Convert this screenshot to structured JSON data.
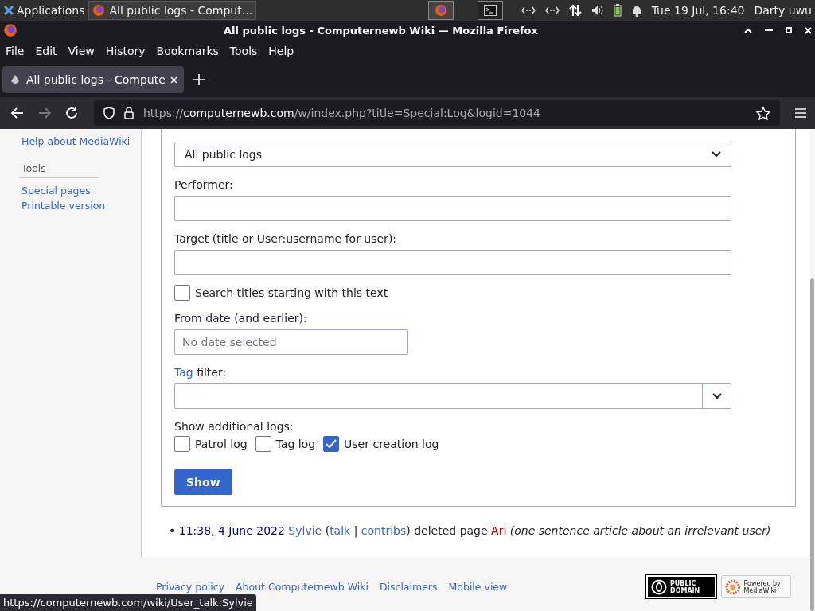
{
  "taskbar": {
    "apps_label": "Applications",
    "window_button": "All public logs - Comput...",
    "clock": "Tue 19 Jul, 16:40",
    "user": "Darty uwu"
  },
  "window": {
    "title": "All public logs - Computernewb Wiki — Mozilla Firefox"
  },
  "menu": [
    "File",
    "Edit",
    "View",
    "History",
    "Bookmarks",
    "Tools",
    "Help"
  ],
  "tabs": [
    {
      "label": "All public logs - Compute",
      "selected": true
    }
  ],
  "address": {
    "scheme": "https://",
    "host": "computernewb.com",
    "path": "/w/index.php?title=Special:Log&logid=1044"
  },
  "sidebar": {
    "links": [
      "Help about MediaWiki"
    ],
    "sections": [
      {
        "heading": "Tools",
        "items": [
          "Special pages",
          "Printable version"
        ]
      }
    ]
  },
  "form": {
    "log_type": {
      "value": "All public logs"
    },
    "performer": {
      "label": "Performer:"
    },
    "target": {
      "label": "Target (title or User:username for user):"
    },
    "prefix": {
      "label": "Search titles starting with this text",
      "checked": false
    },
    "from_date": {
      "label": "From date (and earlier):",
      "placeholder": "No date selected"
    },
    "tag_filter": {
      "link": "Tag",
      "label": " filter:"
    },
    "additional": {
      "label": "Show additional logs:",
      "options": [
        {
          "label": "Patrol log",
          "checked": false
        },
        {
          "label": "Tag log",
          "checked": false
        },
        {
          "label": "User creation log",
          "checked": true
        }
      ]
    },
    "submit": "Show"
  },
  "log_entries": [
    {
      "bullet": "•",
      "time": "11:38, 4 June 2022",
      "user": "Sylvie",
      "open": "(",
      "talk": "talk",
      "separator": "|",
      "contribs": "contribs",
      "action": ") deleted page",
      "page": "Ari",
      "comment": "(one sentence article about an irrelevant user)"
    }
  ],
  "footer": {
    "links": [
      "Privacy policy",
      "About Computernewb Wiki",
      "Disclaimers",
      "Mobile view"
    ],
    "badges": [
      {
        "kind": "license",
        "text": "PUBLIC DOMAIN"
      },
      {
        "kind": "powered",
        "text": "Powered by MediaWiki"
      }
    ]
  },
  "status_url": "https://computernewb.com/wiki/User_talk:Sylvie"
}
